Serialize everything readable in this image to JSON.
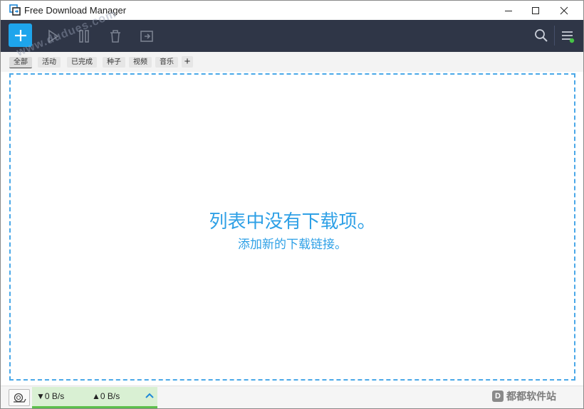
{
  "window": {
    "title": "Free Download Manager"
  },
  "toolbar": {
    "add_tooltip": "Add download",
    "icons": [
      "add-icon",
      "play-icon",
      "pause-icon",
      "delete-icon",
      "move-icon",
      "search-icon",
      "menu-icon"
    ]
  },
  "filters": {
    "tabs": [
      {
        "label": "全部",
        "active": true
      },
      {
        "label": "活动",
        "active": false
      },
      {
        "label": "已完成",
        "active": false
      },
      {
        "label": "种子",
        "active": false
      },
      {
        "label": "视频",
        "active": false
      },
      {
        "label": "音乐",
        "active": false
      }
    ],
    "add_label": "+"
  },
  "empty_state": {
    "message": "列表中没有下载项。",
    "hint": "添加新的下载链接。"
  },
  "status": {
    "download_speed": "▼0 B/s",
    "upload_speed": "▲0 B/s"
  },
  "watermarks": {
    "corner": "都都软件站",
    "corner_logo": "D",
    "diagonal": "www.dudues.com"
  },
  "colors": {
    "toolbar_bg": "#2f3647",
    "accent": "#1ea5ec",
    "speed_bg": "#d9f0d3",
    "speed_bar": "#5cbf4a",
    "notify_dot": "#46c346"
  }
}
